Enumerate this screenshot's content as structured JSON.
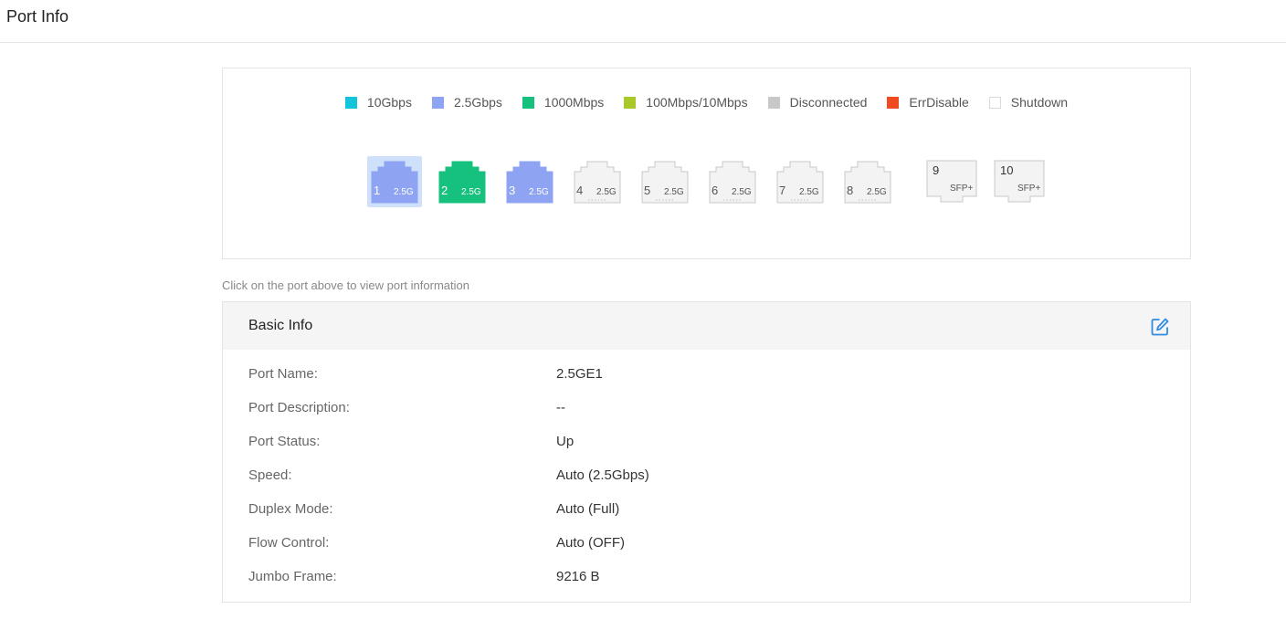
{
  "page": {
    "title": "Port Info"
  },
  "legend": [
    {
      "label": "10Gbps",
      "color": "#12c3dc"
    },
    {
      "label": "2.5Gbps",
      "color": "#8ea4f2"
    },
    {
      "label": "1000Mbps",
      "color": "#16c07d"
    },
    {
      "label": "100Mbps/10Mbps",
      "color": "#a8c928"
    },
    {
      "label": "Disconnected",
      "color": "#c8c8c8"
    },
    {
      "label": "ErrDisable",
      "color": "#ef4a22"
    },
    {
      "label": "Shutdown",
      "color": "#ffffff"
    }
  ],
  "ports": [
    {
      "num": "1",
      "speed": "2.5G",
      "color": "#8ea4f2",
      "state": "active",
      "selected": true
    },
    {
      "num": "2",
      "speed": "2.5G",
      "color": "#16c07d",
      "state": "active",
      "selected": false
    },
    {
      "num": "3",
      "speed": "2.5G",
      "color": "#8ea4f2",
      "state": "active",
      "selected": false
    },
    {
      "num": "4",
      "speed": "2.5G",
      "color": "#f3f3f3",
      "state": "inactive",
      "selected": false
    },
    {
      "num": "5",
      "speed": "2.5G",
      "color": "#f3f3f3",
      "state": "inactive",
      "selected": false
    },
    {
      "num": "6",
      "speed": "2.5G",
      "color": "#f3f3f3",
      "state": "inactive",
      "selected": false
    },
    {
      "num": "7",
      "speed": "2.5G",
      "color": "#f3f3f3",
      "state": "inactive",
      "selected": false
    },
    {
      "num": "8",
      "speed": "2.5G",
      "color": "#f3f3f3",
      "state": "inactive",
      "selected": false
    }
  ],
  "sfp_ports": [
    {
      "num": "9",
      "label": "SFP+"
    },
    {
      "num": "10",
      "label": "SFP+"
    }
  ],
  "hint": "Click on the port above to view port information",
  "basic_info": {
    "title": "Basic Info",
    "edit_icon": "edit-icon",
    "rows": [
      {
        "label": "Port Name:",
        "value": "2.5GE1"
      },
      {
        "label": "Port Description:",
        "value": "--"
      },
      {
        "label": "Port Status:",
        "value": "Up"
      },
      {
        "label": "Speed:",
        "value": "Auto (2.5Gbps)"
      },
      {
        "label": "Duplex Mode:",
        "value": "Auto (Full)"
      },
      {
        "label": "Flow Control:",
        "value": "Auto (OFF)"
      },
      {
        "label": "Jumbo Frame:",
        "value": "9216 B"
      }
    ]
  },
  "colors": {
    "accent": "#2f8ae5",
    "selected_bg": "#cfe0fb"
  }
}
